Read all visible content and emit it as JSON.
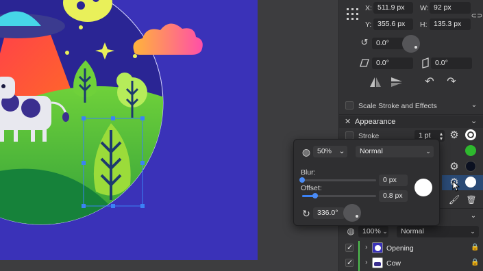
{
  "transform": {
    "x_label": "X:",
    "x_value": "511.9 px",
    "w_label": "W:",
    "w_value": "92 px",
    "y_label": "Y:",
    "y_value": "355.6 px",
    "h_label": "H:",
    "h_value": "135.3 px",
    "rotation_value": "0.0°",
    "skew_value": "0.0°",
    "shear_value": "0.0°",
    "scale_stroke_label": "Scale Stroke and Effects"
  },
  "appearance": {
    "title": "Appearance",
    "stroke_label": "Stroke",
    "stroke_width": "1 pt",
    "swatch_colors": [
      "#ffffff",
      "#2eb82e",
      "#0b1020",
      "#ffffff"
    ]
  },
  "effect_popup": {
    "opacity_value": "50%",
    "blend_mode": "Normal",
    "blur_label": "Blur:",
    "blur_value": "0 px",
    "blur_level": 0.0,
    "offset_label": "Offset:",
    "offset_value": "0.8 px",
    "offset_level": 0.18,
    "angle_value": "336.0°",
    "color": "#ffffff"
  },
  "layers": {
    "opacity_value": "100%",
    "blend_mode": "Normal",
    "items": [
      {
        "name": "Opening"
      },
      {
        "name": "Cow"
      }
    ]
  },
  "colors": {
    "accent": "#3b82f6",
    "canvas_bg": "#3a32b8",
    "panel_bg": "#323234"
  }
}
